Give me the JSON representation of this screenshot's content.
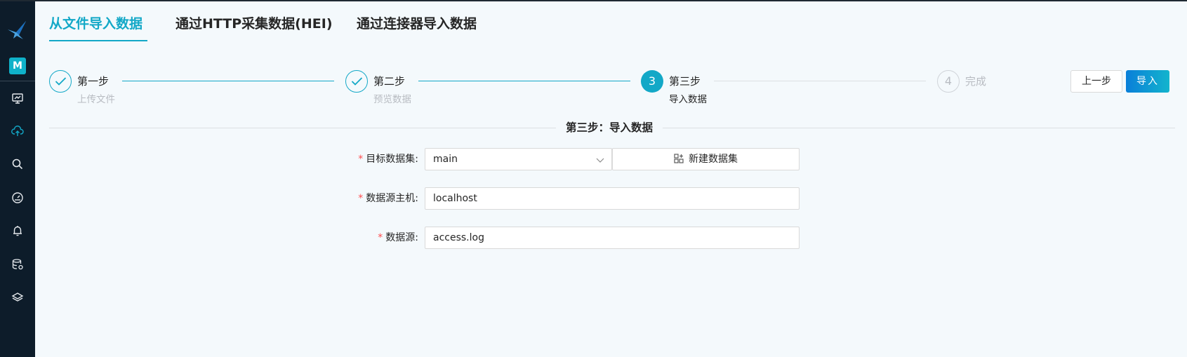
{
  "sidebar": {
    "avatar_letter": "M",
    "accent_color": "#0fb1c9",
    "icons": [
      "logo-bird-icon",
      "monitor-chart-icon",
      "cloud-upload-icon",
      "search-icon",
      "dashboard-gauge-icon",
      "bell-icon",
      "database-settings-icon",
      "layers-icon"
    ],
    "active_icon": "cloud-upload-icon"
  },
  "tabs": [
    {
      "label": "从文件导入数据",
      "active": true
    },
    {
      "label": "通过HTTP采集数据(HEI)",
      "active": false
    },
    {
      "label": "通过连接器导入数据",
      "active": false
    }
  ],
  "steps": [
    {
      "number": "1",
      "title": "第一步",
      "description": "上传文件",
      "status": "done"
    },
    {
      "number": "2",
      "title": "第二步",
      "description": "预览数据",
      "status": "done"
    },
    {
      "number": "3",
      "title": "第三步",
      "description": "导入数据",
      "status": "current"
    },
    {
      "number": "4",
      "title": "完成",
      "description": "",
      "status": "wait"
    }
  ],
  "actions": {
    "prev_label": "上一步",
    "import_label": "导入"
  },
  "section_title": "第三步：导入数据",
  "form": {
    "dataset": {
      "label": "目标数据集:",
      "value": "main",
      "new_button_label": "新建数据集"
    },
    "host": {
      "label": "数据源主机:",
      "value": "localhost"
    },
    "source": {
      "label": "数据源:",
      "value": "access.log"
    }
  },
  "colors": {
    "primary": "#13a8c7",
    "required": "#ff4d4f",
    "sidebar_bg": "#0d1c2a",
    "page_bg": "#f4f9fc"
  }
}
